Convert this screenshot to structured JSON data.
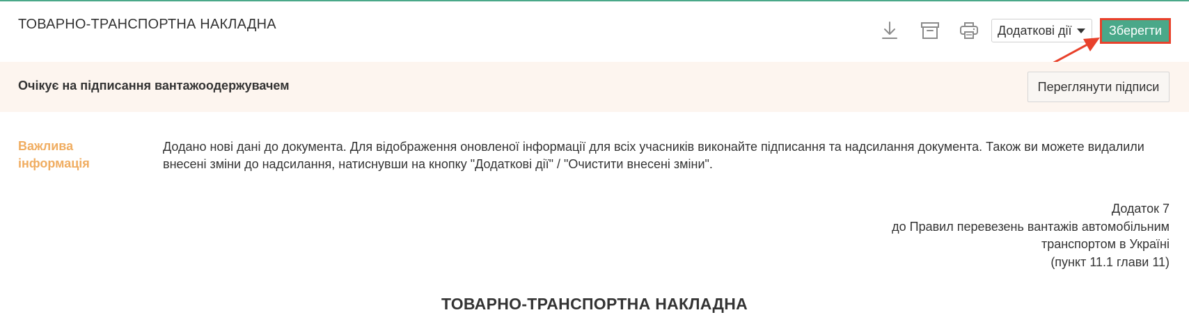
{
  "header": {
    "title": "ТОВАРНО-ТРАНСПОРТНА НАКЛАДНА",
    "icons": {
      "download": "download-icon",
      "archive": "archive-icon",
      "print": "print-icon"
    },
    "actions_label": "Додаткові дії",
    "save_label": "Зберегти"
  },
  "status": {
    "text": "Очікує на підписання вантажоодержувачем",
    "view_signatures_label": "Переглянути підписи"
  },
  "info": {
    "label_line1": "Важлива",
    "label_line2": "інформація",
    "text": "Додано нові дані до документа. Для відображення оновленої інформації для всіх учасників виконайте підписання та надсилання документа. Також ви можете видалили внесені зміни до надсилання, натиснувши на кнопку \"Додаткові дії\" / \"Очистити внесені зміни\"."
  },
  "appendix": {
    "line1": "Додаток 7",
    "line2": "до Правил перевезень вантажів автомобільним",
    "line3": "транспортом в Україні",
    "line4": "(пункт 11.1 глави 11)"
  },
  "document": {
    "heading": "ТОВАРНО-ТРАНСПОРТНА НАКЛАДНА"
  },
  "colors": {
    "accent": "#4aa889",
    "highlight": "#e8412b",
    "warning_label": "#f0ad61",
    "status_bg": "#fdf5ef"
  }
}
